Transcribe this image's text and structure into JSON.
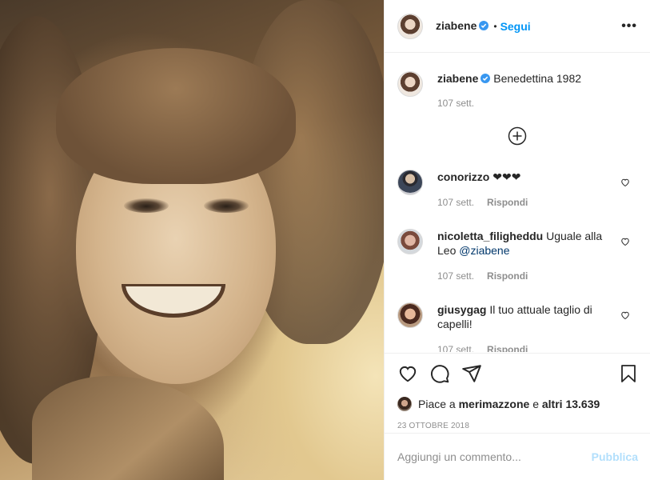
{
  "post": {
    "username": "ziabene",
    "follow_label": "Segui",
    "separator": "•",
    "more_label": "•••"
  },
  "caption": {
    "username": "ziabene",
    "text": "Benedettina 1982",
    "time": "107 sett."
  },
  "comments": [
    {
      "username": "conorizzo",
      "text": "❤❤❤",
      "time": "107 sett.",
      "reply_label": "Rispondi",
      "mention": ""
    },
    {
      "username": "nicoletta_filigheddu",
      "text": "Uguale alla Leo",
      "mention": "@ziabene",
      "time": "107 sett.",
      "reply_label": "Rispondi"
    },
    {
      "username": "giusygag",
      "text": "Il tuo attuale taglio di capelli!",
      "time": "107 sett.",
      "reply_label": "Rispondi",
      "mention": ""
    }
  ],
  "likes": {
    "prefix": "Piace a",
    "user": "merimazzone",
    "middle": "e",
    "others": "altri 13.639"
  },
  "date": "23 OTTOBRE 2018",
  "add_comment": {
    "placeholder": "Aggiungi un commento...",
    "publish_label": "Pubblica"
  },
  "colors": {
    "accent": "#0095f6",
    "publish_disabled": "#b2dffc",
    "mention": "#00376b",
    "muted": "#8e8e8e"
  },
  "icons": [
    "verified-icon",
    "more-icon",
    "expand-icon",
    "heart-icon",
    "comment-icon",
    "share-icon",
    "bookmark-icon"
  ]
}
